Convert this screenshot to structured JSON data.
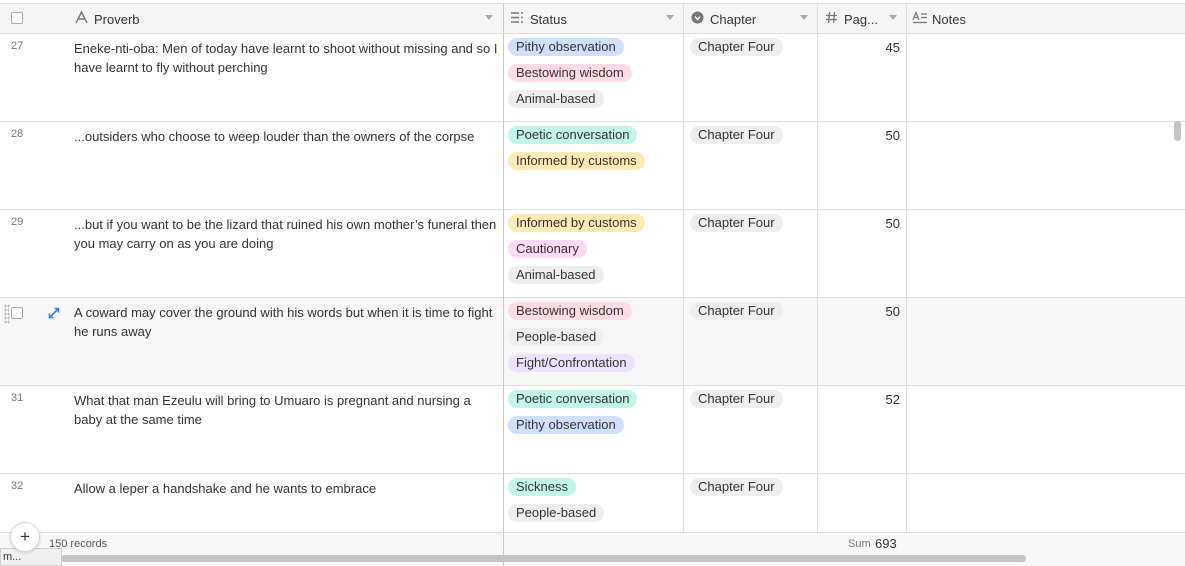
{
  "columns": {
    "proverb": {
      "label": "Proverb",
      "icon": "text-field-icon"
    },
    "status": {
      "label": "Status",
      "icon": "multi-select-icon"
    },
    "chapter": {
      "label": "Chapter",
      "icon": "single-select-icon"
    },
    "page": {
      "label": "Pag...",
      "icon": "number-icon"
    },
    "notes": {
      "label": "Notes",
      "icon": "long-text-icon"
    }
  },
  "colors": {
    "Pithy observation": "#cfdfff",
    "Bestowing wisdom": "#ffdce5",
    "Animal-based": "#eeeeee",
    "Poetic conversation": "#c2f5e9",
    "Informed by customs": "#ffeab6",
    "Cautionary": "#ffdaf6",
    "People-based": "#eeeeee",
    "Fight/Confrontation": "#ede2fe",
    "Sickness": "#c2f5e9"
  },
  "rows": [
    {
      "num": "27",
      "proverb": "Eneke-nti-oba: Men of today have learnt to shoot without missing and so I have learnt to fly without perching",
      "tags": [
        "Pithy observation",
        "Bestowing wisdom",
        "Animal-based"
      ],
      "chapter": "Chapter Four",
      "page": "45"
    },
    {
      "num": "28",
      "proverb": "...outsiders who choose to weep louder than the owners of the corpse",
      "tags": [
        "Poetic conversation",
        "Informed by customs"
      ],
      "chapter": "Chapter Four",
      "page": "50"
    },
    {
      "num": "29",
      "proverb": "...but if you want to be the lizard that ruined his own mother’s funeral then you may carry on as you are doing",
      "tags": [
        "Informed by customs",
        "Cautionary",
        "Animal-based"
      ],
      "chapter": "Chapter Four",
      "page": "50"
    },
    {
      "num": "",
      "proverb": "A coward may cover the ground with his words but when it is time to fight he runs away",
      "tags": [
        "Bestowing wisdom",
        "People-based",
        "Fight/Confrontation"
      ],
      "chapter": "Chapter Four",
      "page": "50"
    },
    {
      "num": "31",
      "proverb": "What that man Ezeulu will bring to Umuaro is pregnant and nursing a baby at the same time",
      "tags": [
        "Poetic conversation",
        "Pithy observation"
      ],
      "chapter": "Chapter Four",
      "page": "52"
    },
    {
      "num": "32",
      "proverb": "Allow a leper a handshake and he wants to embrace",
      "tags": [
        "Sickness",
        "People-based"
      ],
      "chapter": "Chapter Four",
      "page": ""
    }
  ],
  "footer": {
    "add_label": "+",
    "records": "150 records",
    "sum_label": "Sum",
    "sum_value": "693"
  },
  "statusbar": {
    "text": "m..."
  }
}
